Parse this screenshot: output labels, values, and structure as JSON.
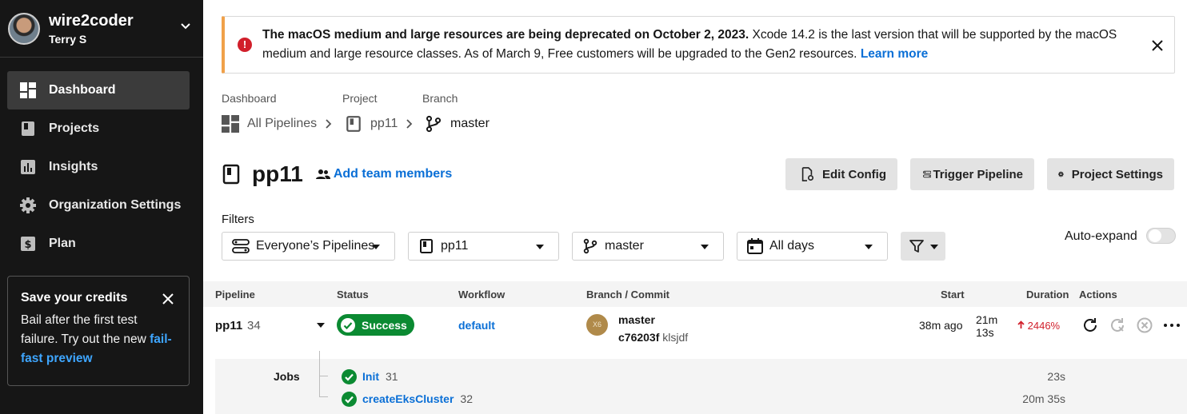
{
  "sidebar": {
    "org_name": "wire2coder",
    "user_name": "Terry S",
    "items": [
      {
        "label": "Dashboard",
        "icon": "dashboard-icon",
        "active": true
      },
      {
        "label": "Projects",
        "icon": "project-icon"
      },
      {
        "label": "Insights",
        "icon": "insights-icon"
      },
      {
        "label": "Organization Settings",
        "icon": "gear-icon"
      },
      {
        "label": "Plan",
        "icon": "dollar-icon"
      }
    ],
    "promo": {
      "title": "Save your credits",
      "body": "Bail after the first test failure. Try out the new",
      "link": "fail-fast preview"
    }
  },
  "banner": {
    "bold": "The macOS medium and large resources are being deprecated on October 2, 2023.",
    "text": " Xcode 14.2 is the last version that will be supported by the macOS medium and large resource classes. As of March 9, Free customers will be upgraded to the Gen2 resources. ",
    "link": "Learn more",
    "accent": "#f0a14a"
  },
  "breadcrumb": {
    "labels": {
      "dashboard": "Dashboard",
      "project": "Project",
      "branch": "Branch"
    },
    "all_pipelines": "All Pipelines",
    "project": "pp11",
    "branch": "master"
  },
  "header": {
    "title": "pp11",
    "add_members": "Add team members",
    "buttons": {
      "edit_config": "Edit Config",
      "trigger_pipeline": "Trigger Pipeline",
      "project_settings": "Project Settings"
    }
  },
  "filters": {
    "label": "Filters",
    "pipelines": "Everyone’s Pipelines",
    "project": "pp11",
    "branch": "master",
    "days": "All days",
    "auto_expand": "Auto-expand",
    "auto_expand_on": false
  },
  "table": {
    "columns": {
      "pipeline": "Pipeline",
      "status": "Status",
      "workflow": "Workflow",
      "branch_commit": "Branch / Commit",
      "start": "Start",
      "duration": "Duration",
      "actions": "Actions"
    },
    "row": {
      "pipeline": "pp11",
      "number": "34",
      "status": "Success",
      "workflow": "default",
      "avatar_text": "X6",
      "branch": "master",
      "commit_hash": "c76203f",
      "commit_msg": "klsjdf",
      "start": "38m ago",
      "duration_line1": "21m",
      "duration_line2": "13s",
      "change": "2446%",
      "status_color": "#0b8a32"
    },
    "jobs_label": "Jobs",
    "jobs": [
      {
        "name": "Init",
        "number": "31",
        "duration": "23s"
      },
      {
        "name": "createEksCluster",
        "number": "32",
        "duration": "20m 35s"
      }
    ]
  }
}
